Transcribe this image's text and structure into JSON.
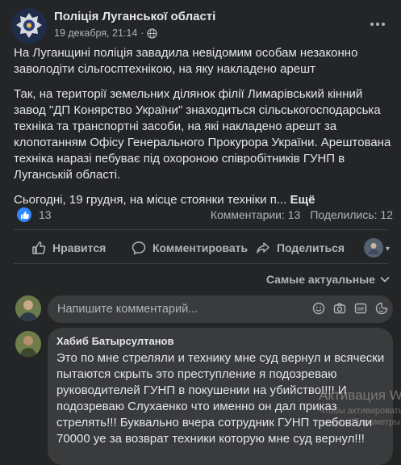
{
  "post": {
    "page_name": "Поліція Луганської області",
    "date": "19 декабря, 21:14",
    "more_icon": "ellipsis-icon",
    "paragraph1": "На Луганщині поліція завадила невідомим особам незаконно заволодіти  сільгосптехнікою, на яку накладено арешт",
    "paragraph2": "Так, на території земельних ділянок філії Лимарівський кінний завод \"ДП Конярство України\" знаходиться сільськогосподарська техніка та транспортні засоби, на які накладено арешт за клопотанням Офісу Генерального Прокурора України. Арештована техніка наразі  пебуває під охороною співробітників ГУНП в Луганській області.",
    "paragraph3": "Сьогодні, 19 грудня, на місце стоянки техніки п...",
    "more_label": "Ещё"
  },
  "reactions": {
    "count": "13",
    "comments": "Комментарии: 13",
    "shares": "Поделились: 12"
  },
  "actions": {
    "like": "Нравится",
    "comment": "Комментировать",
    "share": "Поделиться"
  },
  "sort": {
    "label": "Самые актуальные"
  },
  "composer": {
    "placeholder": "Напишите комментарий..."
  },
  "comment": {
    "author": "Хабиб Батырсултанов",
    "text": "Это по мне стреляли и технику мне суд вернул и всячески пытаются скрыть это преступление я подозреваю руководителей ГУНП в покушении на убийство!!!! И подозреваю Слухаенко что именно он дал приказ стрелять!!! Буквально вчера сотрудник ГУНП требовали 70000 уе за возврат техники которую мне суд вернул!!!"
  },
  "watermark": {
    "title": "Активация Win",
    "line1": "Чтобы активировать",
    "line2": "раздел \"Параметры"
  },
  "colors": {
    "background": "#242526",
    "bubble": "#3a3b3c",
    "text": "#e4e6eb",
    "secondary": "#b0b3b8",
    "like_blue": "#2d88ff"
  }
}
